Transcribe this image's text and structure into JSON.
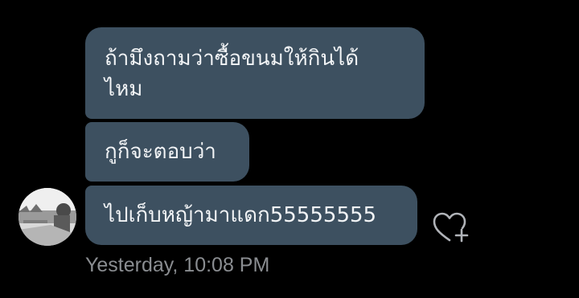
{
  "messages": [
    {
      "text": "ถ้ามึงถามว่าซื้อขนมให้กินได้\nไหม"
    },
    {
      "text": "กูก็จะตอบว่า"
    },
    {
      "text": "ไปเก็บหญ้ามาแดก55555555"
    }
  ],
  "timestamp": "Yesterday, 10:08 PM",
  "icons": {
    "avatar": "avatar",
    "react": "heart-plus-icon"
  },
  "colors": {
    "background": "#000000",
    "bubble": "#3d5060",
    "bubble_text": "#f2f4f6",
    "timestamp": "#8a8d91",
    "icon": "#b0b3b8"
  }
}
